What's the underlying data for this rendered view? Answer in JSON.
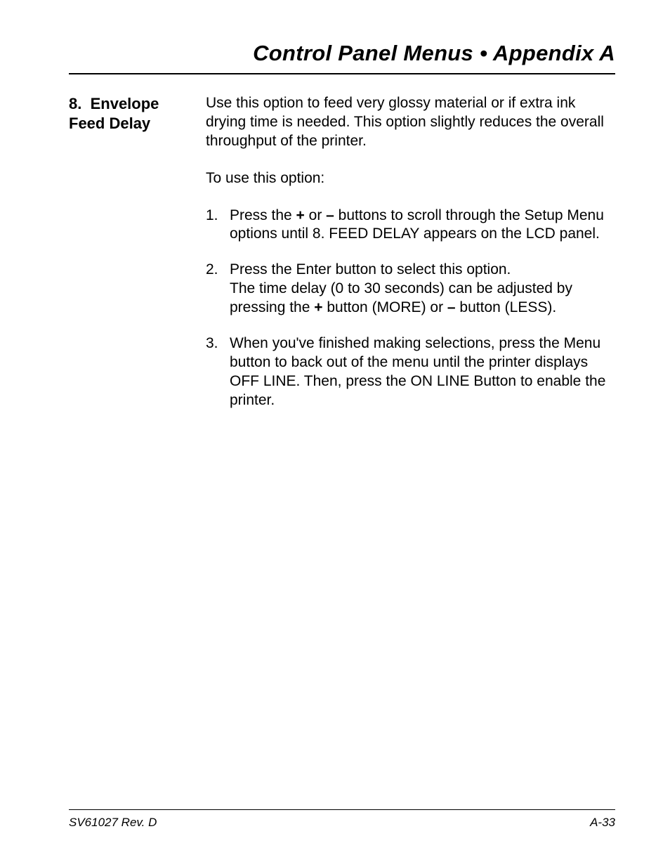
{
  "header": {
    "title": "Control Panel Menus • Appendix A"
  },
  "section": {
    "number": "8.",
    "title_line1": "Envelope",
    "title_line2": "Feed Delay"
  },
  "body": {
    "intro": "Use this option to feed very glossy material or if extra ink drying time is needed. This option slightly reduces the overall throughput of the printer.",
    "lead": "To use this option:",
    "steps": [
      {
        "num": "1.",
        "text_before_bold1": "Press the ",
        "bold1": "+",
        "text_mid": " or ",
        "bold2": "–",
        "text_after": " buttons to scroll through the Setup Menu options until 8. FEED DELAY appears on the LCD panel."
      },
      {
        "num": "2.",
        "line1": "Press the Enter button to select this option.",
        "line2_before": "The time delay (0 to 30 seconds) can be adjusted by pressing the ",
        "bold1": "+",
        "line2_mid": " button (MORE) or ",
        "bold2": "–",
        "line2_after": " button (LESS)."
      },
      {
        "num": "3.",
        "text": "When you've finished making selections, press the Menu button to back out of the menu until the printer displays OFF LINE. Then, press the ON LINE Button to enable the printer."
      }
    ]
  },
  "footer": {
    "left": "SV61027 Rev. D",
    "right": "A-33"
  }
}
